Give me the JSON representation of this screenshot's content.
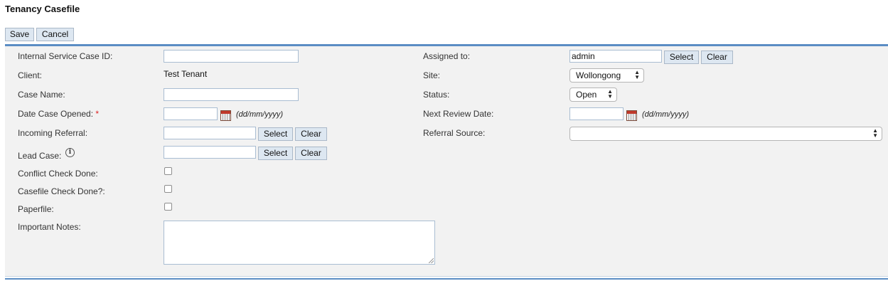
{
  "page": {
    "title": "Tenancy Casefile"
  },
  "toolbar": {
    "save_label": "Save",
    "cancel_label": "Cancel"
  },
  "form": {
    "left": {
      "internal_id": {
        "label": "Internal Service Case ID:",
        "value": ""
      },
      "client": {
        "label": "Client:",
        "value": "Test Tenant"
      },
      "case_name": {
        "label": "Case Name:",
        "value": ""
      },
      "date_opened": {
        "label": "Date Case Opened:",
        "required_mark": "*",
        "value": "",
        "format_hint": "(dd/mm/yyyy)"
      },
      "incoming_referral": {
        "label": "Incoming Referral:",
        "value": "",
        "select_label": "Select",
        "clear_label": "Clear"
      },
      "lead_case": {
        "label": "Lead Case:",
        "info_glyph": "i",
        "value": "",
        "select_label": "Select",
        "clear_label": "Clear"
      },
      "conflict_check": {
        "label": "Conflict Check Done:",
        "checked": false
      },
      "casefile_check": {
        "label": "Casefile Check Done?:",
        "checked": false
      },
      "paperfile": {
        "label": "Paperfile:",
        "checked": false
      },
      "important_notes": {
        "label": "Important Notes:",
        "value": ""
      }
    },
    "right": {
      "assigned_to": {
        "label": "Assigned to:",
        "value": "admin",
        "select_label": "Select",
        "clear_label": "Clear"
      },
      "site": {
        "label": "Site:",
        "value": "Wollongong"
      },
      "status": {
        "label": "Status:",
        "value": "Open"
      },
      "next_review": {
        "label": "Next Review Date:",
        "value": "",
        "format_hint": "(dd/mm/yyyy)"
      },
      "referral_source": {
        "label": "Referral Source:",
        "value": ""
      }
    }
  },
  "colors": {
    "accent": "#5b8dc4",
    "panel_bg": "#f2f2f2",
    "button_bg": "#dde7f1",
    "required": "#dd2222"
  }
}
